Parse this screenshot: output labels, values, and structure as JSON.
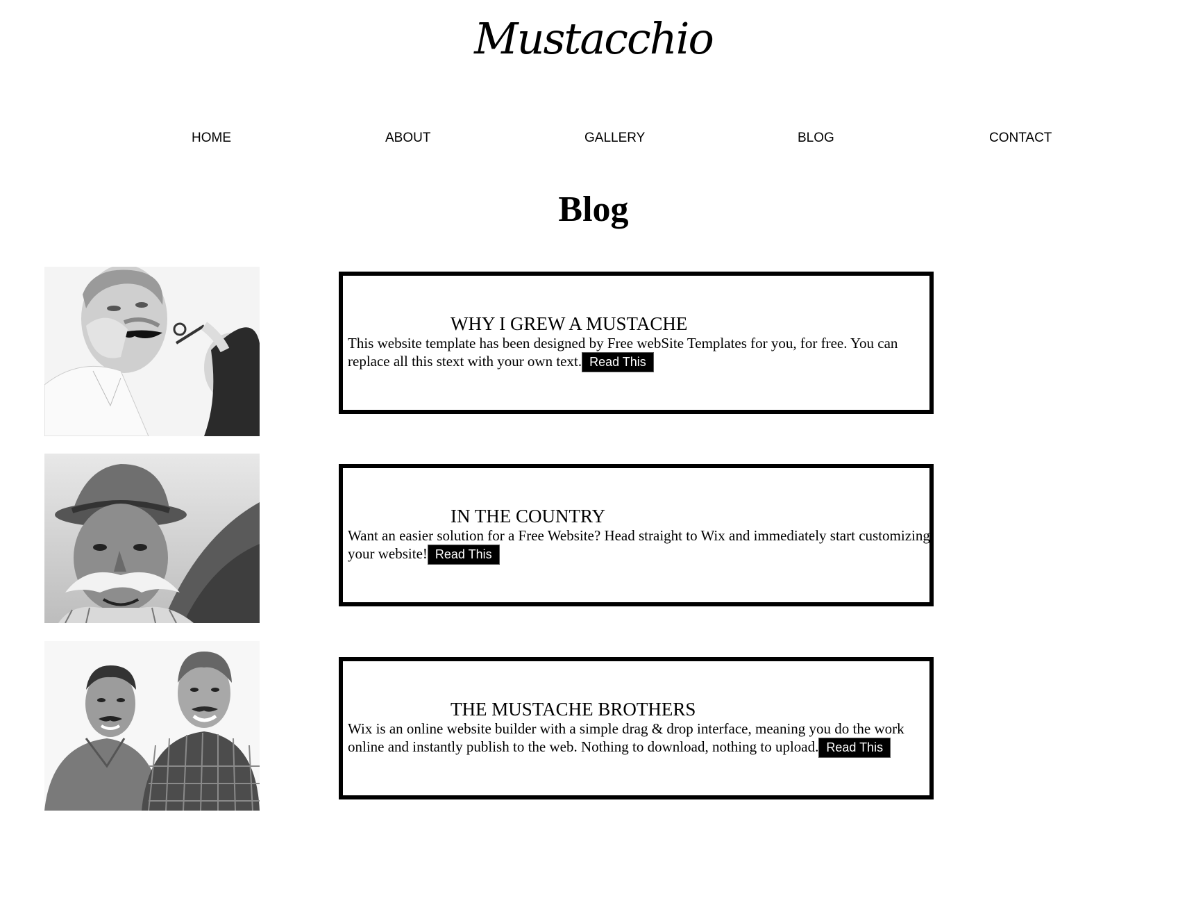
{
  "header": {
    "logo": "Mustacchio"
  },
  "nav": {
    "items": [
      "HOME",
      "ABOUT",
      "GALLERY",
      "BLOG",
      "CONTACT"
    ]
  },
  "page": {
    "title": "Blog"
  },
  "posts": [
    {
      "title": "WHY I GREW A MUSTACHE",
      "text": "This website template has been designed by Free webSite Templates for you, for free. You can replace all this stext with your own text.",
      "button": "Read This",
      "image": "girl-drawing-mustache-on-man-photo"
    },
    {
      "title": "IN THE COUNTRY",
      "text": "Want an easier solution for a Free Website? Head straight to Wix and immediately start customizing your website!",
      "button": "Read This",
      "image": "man-with-hat-and-mustache-photo"
    },
    {
      "title": "THE MUSTACHE BROTHERS",
      "text": "Wix is an online website builder with a simple drag & drop interface, meaning you do the work online and instantly publish to the web. Nothing to download, nothing to upload.",
      "button": "Read This",
      "image": "two-men-with-mustaches-photo"
    }
  ],
  "colors": {
    "background": "#ffffff",
    "text": "#000000",
    "button_bg": "#000000",
    "button_text": "#ffffff"
  }
}
